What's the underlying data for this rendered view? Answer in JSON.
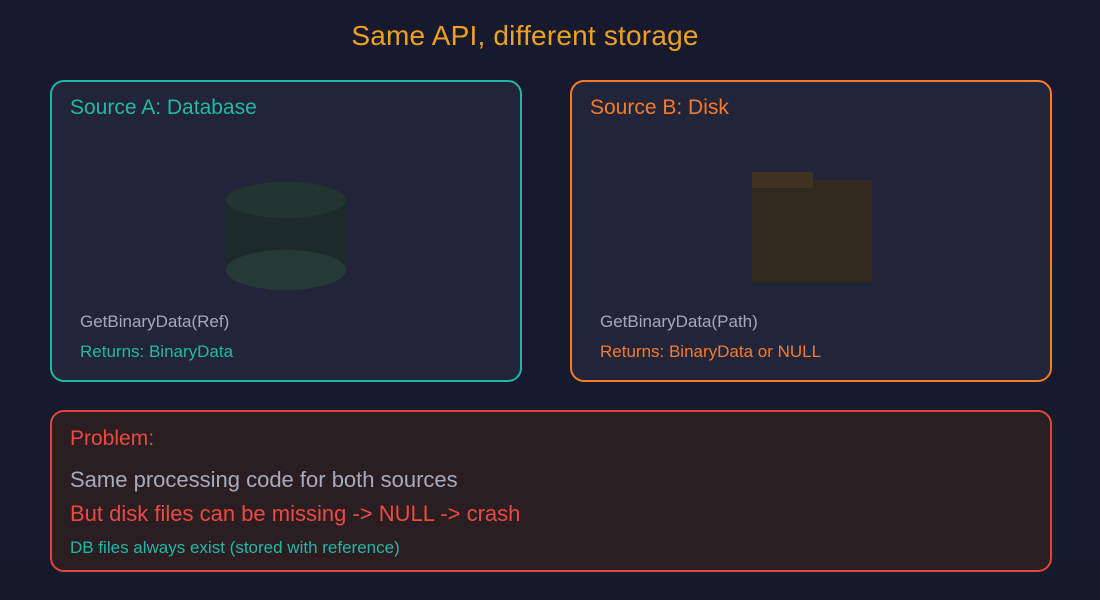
{
  "title": "Same API, different storage",
  "source_a": {
    "title": "Source A: Database",
    "icon": "database-icon",
    "call": "GetBinaryData(Ref)",
    "returns": "Returns: BinaryData",
    "color": "#20b5a5"
  },
  "source_b": {
    "title": "Source B: Disk",
    "icon": "folder-icon",
    "call": "GetBinaryData(Path)",
    "returns": "Returns: BinaryData or NULL",
    "color": "#f57c28"
  },
  "problem": {
    "title": "Problem:",
    "line1": "Same processing code for both sources",
    "line2": "But disk files can be missing -> NULL -> crash",
    "line3": "DB files always exist (stored with reference)",
    "color": "#e0463e"
  }
}
